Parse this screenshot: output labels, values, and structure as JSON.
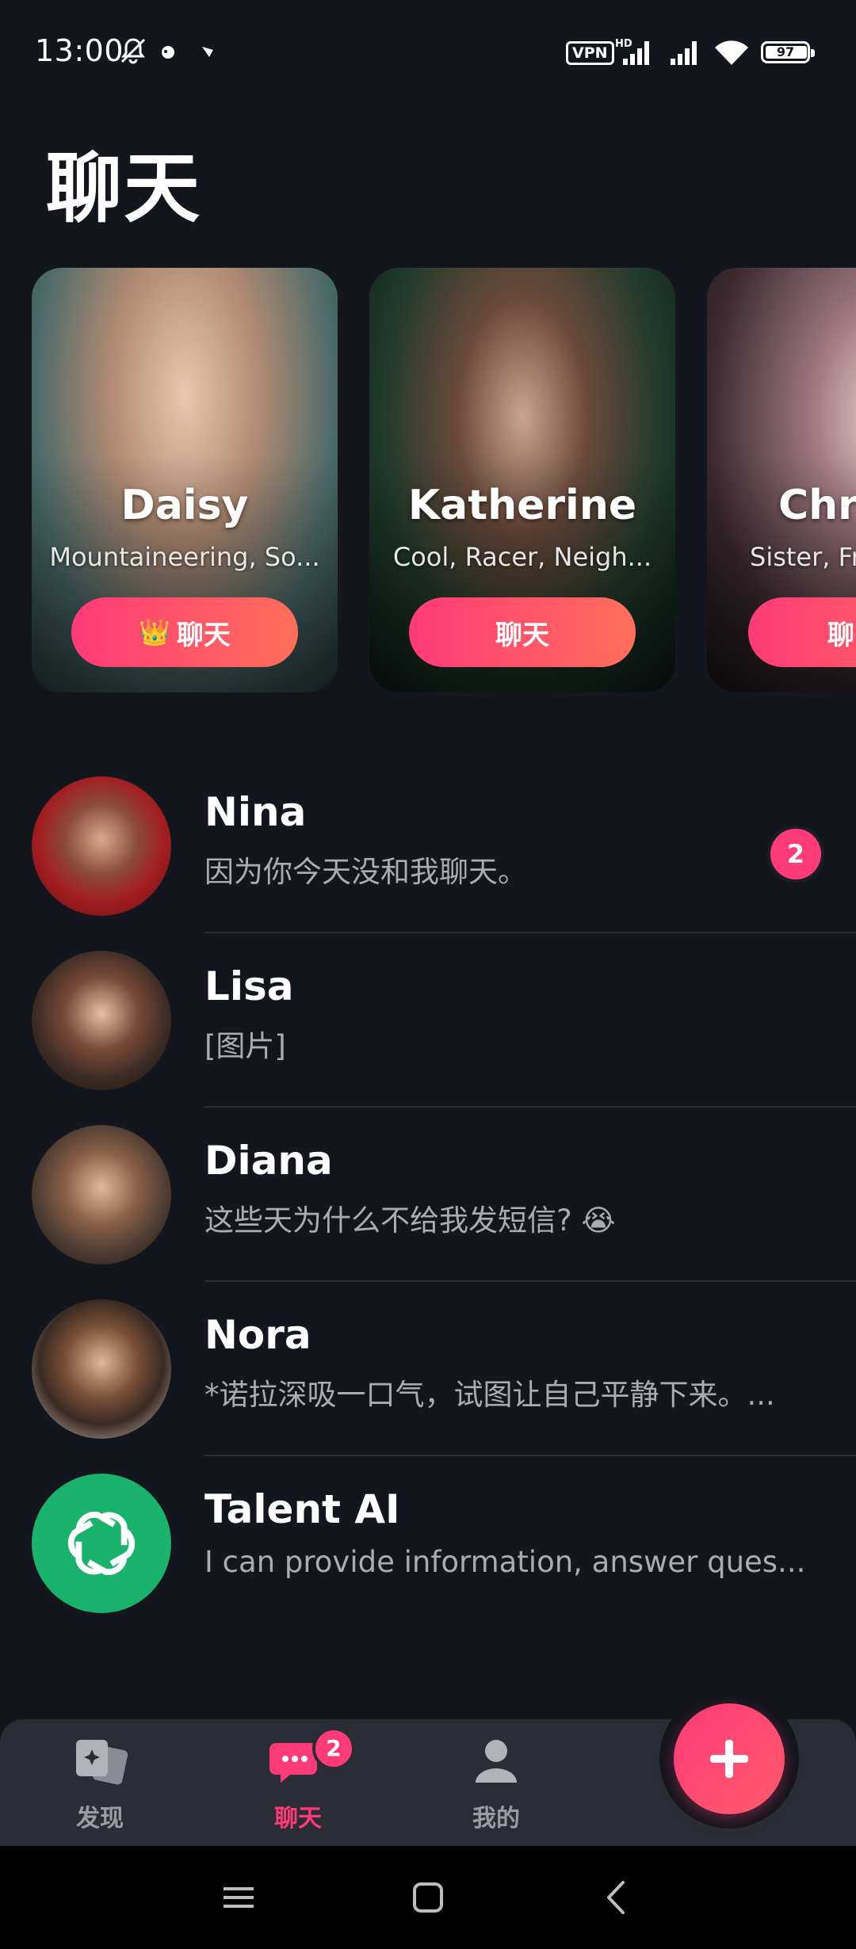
{
  "status_bar": {
    "time": "13:00",
    "vpn": "VPN",
    "hd": "HD",
    "battery": "97",
    "icons": [
      "bell-off-icon",
      "notification-icon",
      "notification-icon",
      "signal-icon",
      "signal-icon",
      "wifi-icon",
      "battery-icon"
    ]
  },
  "page": {
    "title": "聊天"
  },
  "featured": [
    {
      "name": "Daisy",
      "tags": "Mountaineering, So...",
      "button": "聊天",
      "crown": "👑"
    },
    {
      "name": "Katherine",
      "tags": "Cool, Racer, Neigh...",
      "button": "聊天"
    },
    {
      "name": "Chri",
      "tags": "Sister, Fr",
      "button": "聊"
    }
  ],
  "conversations": [
    {
      "name": "Nina",
      "preview": "因为你今天没和我聊天。",
      "badge": "2"
    },
    {
      "name": "Lisa",
      "preview": "[图片]"
    },
    {
      "name": "Diana",
      "preview": "这些天为什么不给我发短信? 😭"
    },
    {
      "name": "Nora",
      "preview": "*诺拉深吸一口气，试图让自己平静下来。..."
    },
    {
      "name": "Talent AI",
      "preview": "I can provide information, answer ques..."
    }
  ],
  "bottom_nav": {
    "discover": "发现",
    "chat": "聊天",
    "chat_badge": "2",
    "me": "我的"
  },
  "colors": {
    "background": "#14161d",
    "accent": "#ff3a78",
    "nav_bg": "#2a2d35",
    "ai_green": "#19b36b"
  }
}
